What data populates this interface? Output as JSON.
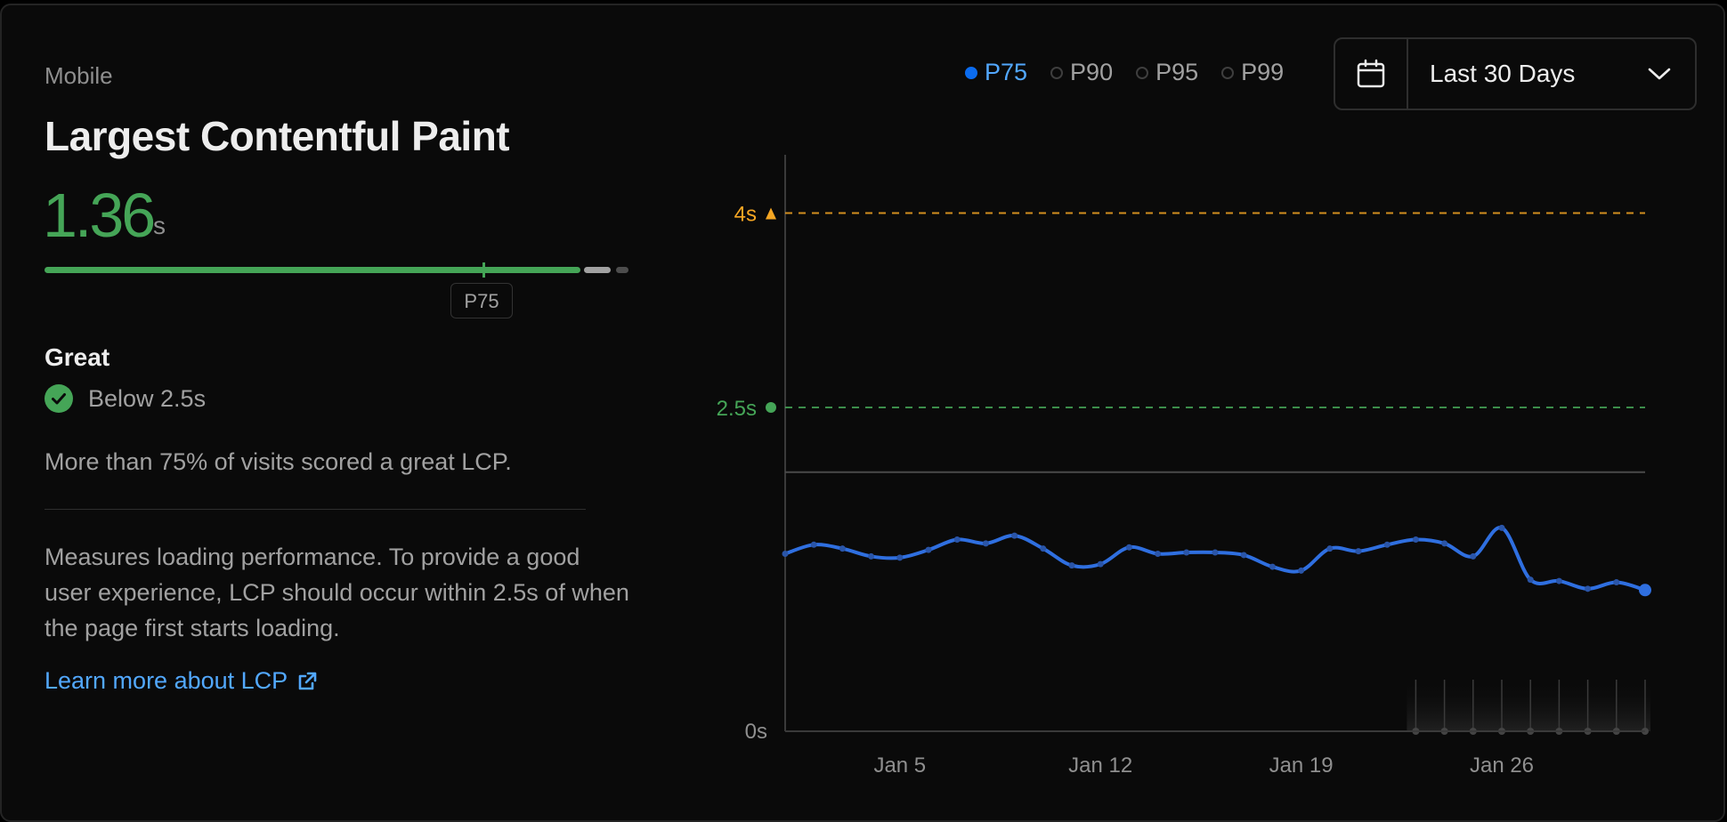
{
  "header": {
    "device": "Mobile",
    "title": "Largest Contentful Paint",
    "score_value": "1.36",
    "score_unit": "s",
    "p75_tag": "P75"
  },
  "rating": {
    "label": "Great",
    "threshold_text": "Below 2.5s",
    "summary": "More than 75% of visits scored a great LCP."
  },
  "description": "Measures loading performance. To provide a good user experience, LCP should occur within 2.5s of when the page first starts loading.",
  "learn_more": {
    "label": "Learn more about LCP"
  },
  "legend": {
    "items": [
      {
        "label": "P75",
        "active": true
      },
      {
        "label": "P90",
        "active": false
      },
      {
        "label": "P95",
        "active": false
      },
      {
        "label": "P99",
        "active": false
      }
    ]
  },
  "date_range": {
    "label": "Last 30 Days"
  },
  "icons": {
    "check": "check-circle-icon",
    "external_link": "external-link-icon",
    "calendar": "calendar-icon",
    "chevron": "chevron-down-icon"
  },
  "colors": {
    "great": "#45a557",
    "warning": "#f5a623",
    "series": "#2f6fe0",
    "link": "#52a8ff"
  },
  "chart_data": {
    "type": "line",
    "y_ticks": [
      {
        "value": 0,
        "label": "0s"
      },
      {
        "value": 2.5,
        "label": "2.5s"
      },
      {
        "value": 4,
        "label": "4s"
      }
    ],
    "x_ticks": [
      "Jan 5",
      "Jan 12",
      "Jan 19",
      "Jan 26"
    ],
    "ylim": [
      0,
      4.45
    ],
    "thresholds": [
      {
        "value": 2.5,
        "label": "2.5s",
        "marker": "circle",
        "color": "#45a557"
      },
      {
        "value": 4,
        "label": "4s",
        "marker": "triangle",
        "color": "#f5a623"
      }
    ],
    "reference_line": 2.0,
    "series": [
      {
        "name": "P75",
        "x": [
          "Jan 1",
          "Jan 2",
          "Jan 3",
          "Jan 4",
          "Jan 5",
          "Jan 6",
          "Jan 7",
          "Jan 8",
          "Jan 9",
          "Jan 10",
          "Jan 11",
          "Jan 12",
          "Jan 13",
          "Jan 14",
          "Jan 15",
          "Jan 16",
          "Jan 17",
          "Jan 18",
          "Jan 19",
          "Jan 20",
          "Jan 21",
          "Jan 22",
          "Jan 23",
          "Jan 24",
          "Jan 25",
          "Jan 26",
          "Jan 27",
          "Jan 28",
          "Jan 29",
          "Jan 30",
          "Jan 31"
        ],
        "values": [
          1.37,
          1.44,
          1.41,
          1.35,
          1.34,
          1.4,
          1.48,
          1.45,
          1.51,
          1.41,
          1.28,
          1.29,
          1.42,
          1.37,
          1.38,
          1.38,
          1.36,
          1.27,
          1.24,
          1.41,
          1.39,
          1.44,
          1.48,
          1.45,
          1.35,
          1.57,
          1.17,
          1.16,
          1.1,
          1.15,
          1.09
        ]
      }
    ],
    "samples": {
      "x": [
        "Jan 23",
        "Jan 24",
        "Jan 25",
        "Jan 26",
        "Jan 27",
        "Jan 28",
        "Jan 29",
        "Jan 30",
        "Jan 31"
      ]
    }
  }
}
